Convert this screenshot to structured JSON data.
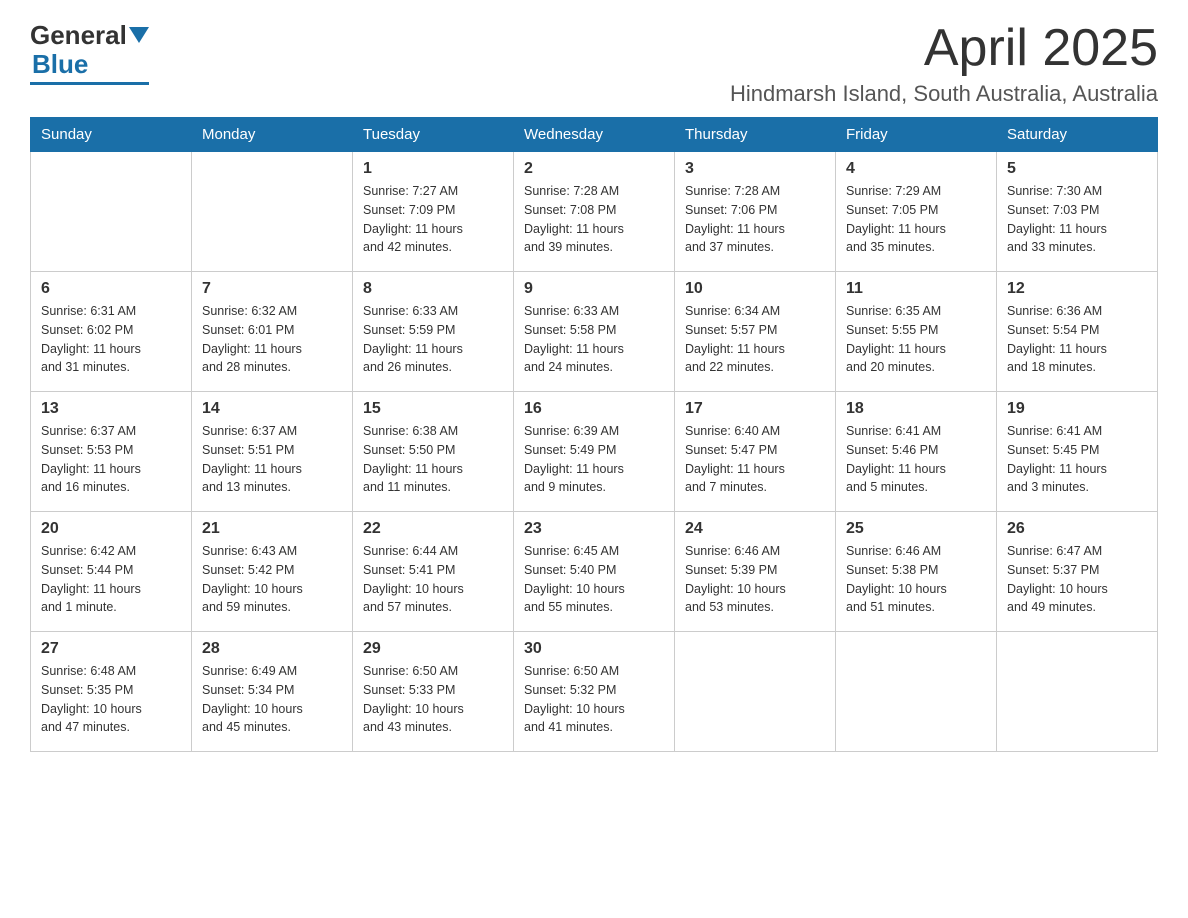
{
  "logo": {
    "general": "General",
    "blue": "Blue"
  },
  "header": {
    "month_title": "April 2025",
    "location": "Hindmarsh Island, South Australia, Australia"
  },
  "days_of_week": [
    "Sunday",
    "Monday",
    "Tuesday",
    "Wednesday",
    "Thursday",
    "Friday",
    "Saturday"
  ],
  "weeks": [
    [
      {
        "day": "",
        "info": ""
      },
      {
        "day": "",
        "info": ""
      },
      {
        "day": "1",
        "info": "Sunrise: 7:27 AM\nSunset: 7:09 PM\nDaylight: 11 hours\nand 42 minutes."
      },
      {
        "day": "2",
        "info": "Sunrise: 7:28 AM\nSunset: 7:08 PM\nDaylight: 11 hours\nand 39 minutes."
      },
      {
        "day": "3",
        "info": "Sunrise: 7:28 AM\nSunset: 7:06 PM\nDaylight: 11 hours\nand 37 minutes."
      },
      {
        "day": "4",
        "info": "Sunrise: 7:29 AM\nSunset: 7:05 PM\nDaylight: 11 hours\nand 35 minutes."
      },
      {
        "day": "5",
        "info": "Sunrise: 7:30 AM\nSunset: 7:03 PM\nDaylight: 11 hours\nand 33 minutes."
      }
    ],
    [
      {
        "day": "6",
        "info": "Sunrise: 6:31 AM\nSunset: 6:02 PM\nDaylight: 11 hours\nand 31 minutes."
      },
      {
        "day": "7",
        "info": "Sunrise: 6:32 AM\nSunset: 6:01 PM\nDaylight: 11 hours\nand 28 minutes."
      },
      {
        "day": "8",
        "info": "Sunrise: 6:33 AM\nSunset: 5:59 PM\nDaylight: 11 hours\nand 26 minutes."
      },
      {
        "day": "9",
        "info": "Sunrise: 6:33 AM\nSunset: 5:58 PM\nDaylight: 11 hours\nand 24 minutes."
      },
      {
        "day": "10",
        "info": "Sunrise: 6:34 AM\nSunset: 5:57 PM\nDaylight: 11 hours\nand 22 minutes."
      },
      {
        "day": "11",
        "info": "Sunrise: 6:35 AM\nSunset: 5:55 PM\nDaylight: 11 hours\nand 20 minutes."
      },
      {
        "day": "12",
        "info": "Sunrise: 6:36 AM\nSunset: 5:54 PM\nDaylight: 11 hours\nand 18 minutes."
      }
    ],
    [
      {
        "day": "13",
        "info": "Sunrise: 6:37 AM\nSunset: 5:53 PM\nDaylight: 11 hours\nand 16 minutes."
      },
      {
        "day": "14",
        "info": "Sunrise: 6:37 AM\nSunset: 5:51 PM\nDaylight: 11 hours\nand 13 minutes."
      },
      {
        "day": "15",
        "info": "Sunrise: 6:38 AM\nSunset: 5:50 PM\nDaylight: 11 hours\nand 11 minutes."
      },
      {
        "day": "16",
        "info": "Sunrise: 6:39 AM\nSunset: 5:49 PM\nDaylight: 11 hours\nand 9 minutes."
      },
      {
        "day": "17",
        "info": "Sunrise: 6:40 AM\nSunset: 5:47 PM\nDaylight: 11 hours\nand 7 minutes."
      },
      {
        "day": "18",
        "info": "Sunrise: 6:41 AM\nSunset: 5:46 PM\nDaylight: 11 hours\nand 5 minutes."
      },
      {
        "day": "19",
        "info": "Sunrise: 6:41 AM\nSunset: 5:45 PM\nDaylight: 11 hours\nand 3 minutes."
      }
    ],
    [
      {
        "day": "20",
        "info": "Sunrise: 6:42 AM\nSunset: 5:44 PM\nDaylight: 11 hours\nand 1 minute."
      },
      {
        "day": "21",
        "info": "Sunrise: 6:43 AM\nSunset: 5:42 PM\nDaylight: 10 hours\nand 59 minutes."
      },
      {
        "day": "22",
        "info": "Sunrise: 6:44 AM\nSunset: 5:41 PM\nDaylight: 10 hours\nand 57 minutes."
      },
      {
        "day": "23",
        "info": "Sunrise: 6:45 AM\nSunset: 5:40 PM\nDaylight: 10 hours\nand 55 minutes."
      },
      {
        "day": "24",
        "info": "Sunrise: 6:46 AM\nSunset: 5:39 PM\nDaylight: 10 hours\nand 53 minutes."
      },
      {
        "day": "25",
        "info": "Sunrise: 6:46 AM\nSunset: 5:38 PM\nDaylight: 10 hours\nand 51 minutes."
      },
      {
        "day": "26",
        "info": "Sunrise: 6:47 AM\nSunset: 5:37 PM\nDaylight: 10 hours\nand 49 minutes."
      }
    ],
    [
      {
        "day": "27",
        "info": "Sunrise: 6:48 AM\nSunset: 5:35 PM\nDaylight: 10 hours\nand 47 minutes."
      },
      {
        "day": "28",
        "info": "Sunrise: 6:49 AM\nSunset: 5:34 PM\nDaylight: 10 hours\nand 45 minutes."
      },
      {
        "day": "29",
        "info": "Sunrise: 6:50 AM\nSunset: 5:33 PM\nDaylight: 10 hours\nand 43 minutes."
      },
      {
        "day": "30",
        "info": "Sunrise: 6:50 AM\nSunset: 5:32 PM\nDaylight: 10 hours\nand 41 minutes."
      },
      {
        "day": "",
        "info": ""
      },
      {
        "day": "",
        "info": ""
      },
      {
        "day": "",
        "info": ""
      }
    ]
  ]
}
